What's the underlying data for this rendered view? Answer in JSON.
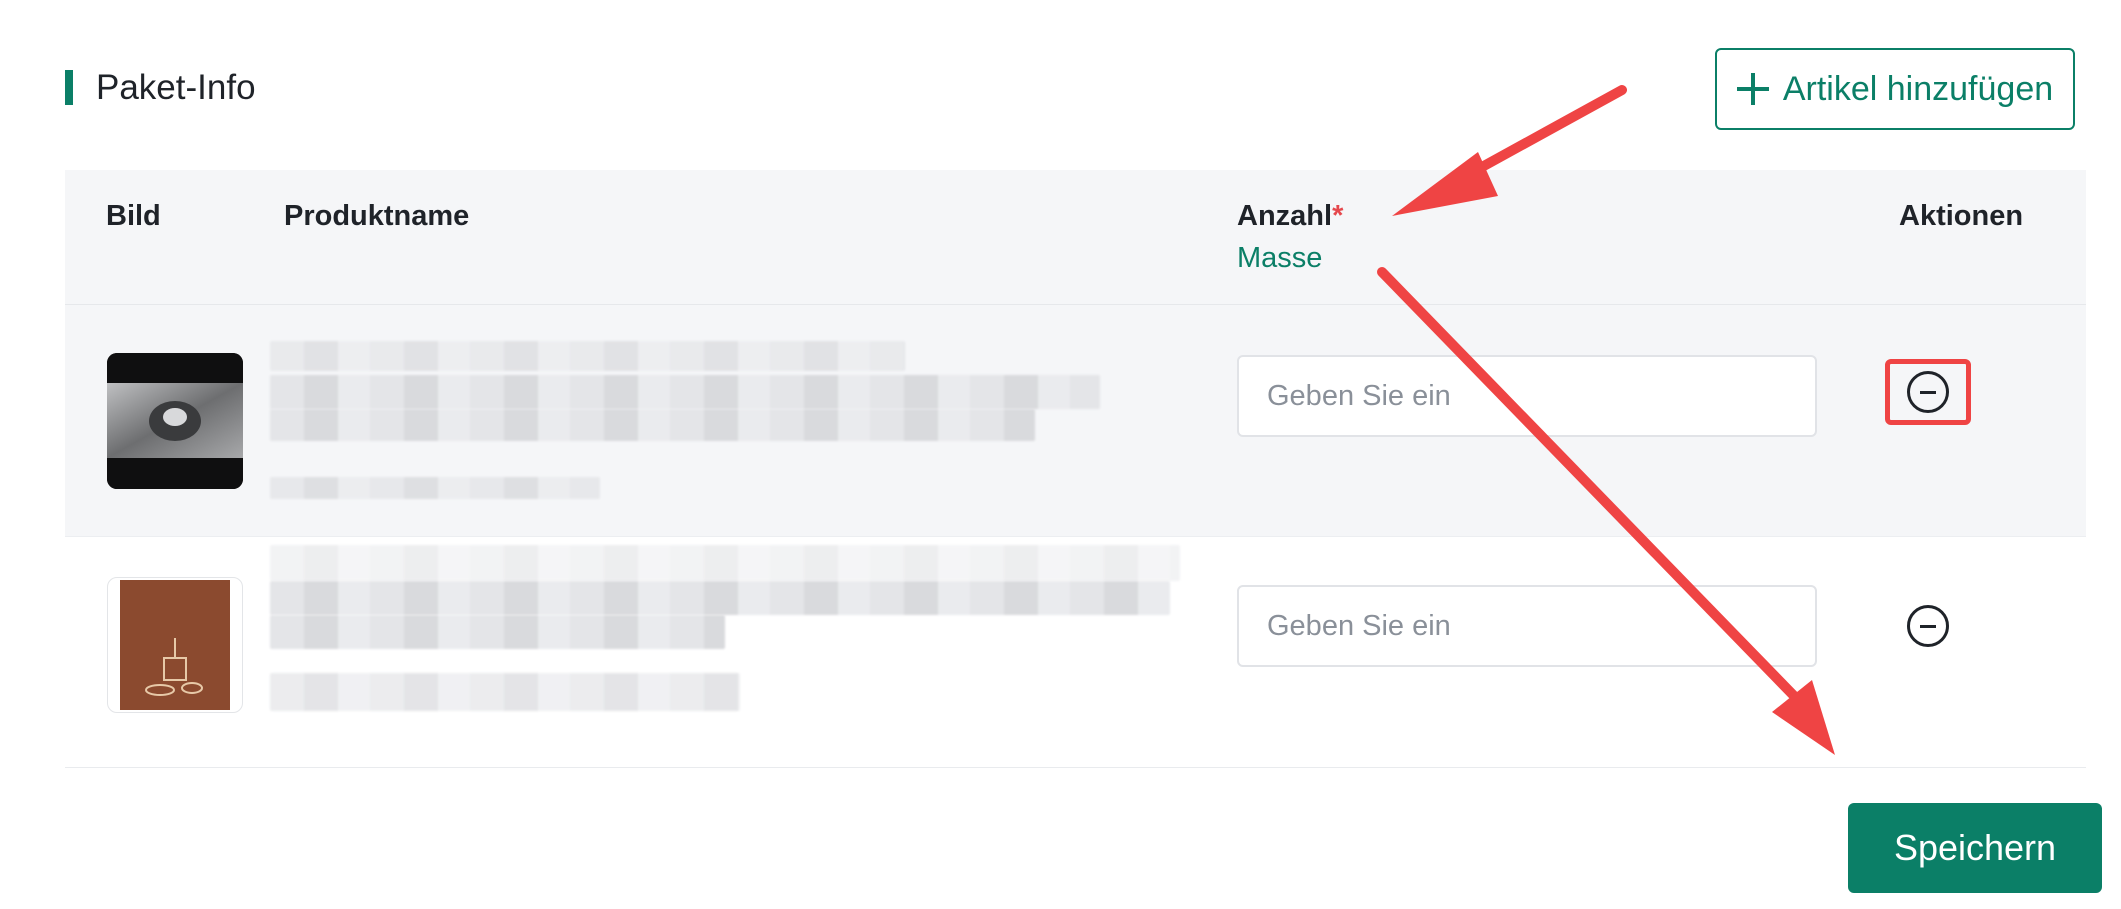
{
  "section": {
    "title": "Paket-Info"
  },
  "toolbar": {
    "add_label": "Artikel hinzufügen"
  },
  "table": {
    "headers": {
      "image": "Bild",
      "product": "Produktname",
      "quantity": "Anzahl",
      "quantity_required": "*",
      "bulk": "Masse",
      "actions": "Aktionen"
    },
    "rows": [
      {
        "quantity_placeholder": "Geben Sie ein",
        "quantity_value": ""
      },
      {
        "quantity_placeholder": "Geben Sie ein",
        "quantity_value": ""
      }
    ]
  },
  "footer": {
    "save_label": "Speichern"
  },
  "colors": {
    "accent": "#0b7f67",
    "annotation": "#ef4444",
    "required": "#e5484d"
  },
  "icons": {
    "add": "plus-icon",
    "remove": "minus-circle-icon"
  }
}
